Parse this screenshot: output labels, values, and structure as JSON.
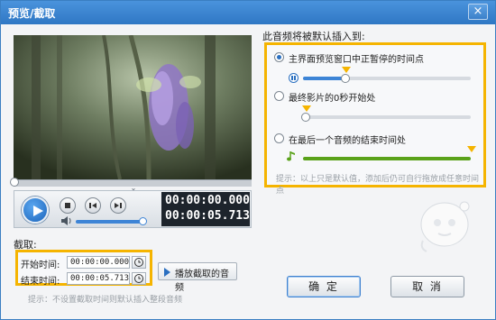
{
  "window": {
    "title": "预览/截取",
    "close_glyph": "×"
  },
  "player": {
    "current_time": "00:00:00.000",
    "total_time": "00:00:05.713",
    "collapse_glyph": "⌄",
    "volume_level": 1.0,
    "progress_level": 0.0
  },
  "insert": {
    "heading": "此音频将被默认插入到:",
    "options": [
      {
        "label": "主界面预览窗口中正暂停的时间点",
        "selected": true
      },
      {
        "label": "最终影片的0秒开始处",
        "selected": false
      },
      {
        "label": "在最后一个音频的结束时间处",
        "selected": false
      }
    ],
    "hint": "提示：以上只是默认值，添加后仍可自行拖放成任意时间点",
    "slider_levels": [
      0.4,
      0.0,
      1.0
    ]
  },
  "trim": {
    "heading": "截取:",
    "start_label": "开始时间:",
    "start_value": "00:00:00.000",
    "end_label": "结束时间:",
    "end_value": "00:00:05.713",
    "play_button": "播放截取的音频",
    "hint": "提示：不设置截取时间则默认插入整段音频"
  },
  "buttons": {
    "ok": "确 定",
    "cancel": "取 消"
  },
  "icons": {
    "play": "play-icon",
    "stop": "stop-icon",
    "prev": "previous-icon",
    "next": "next-icon",
    "volume": "volume-icon",
    "clock": "clock-icon",
    "music": "music-note-icon",
    "mascot": "mascot-icon"
  },
  "colors": {
    "accent": "#3d84d6",
    "highlight": "#f5b400",
    "green": "#5aa21a"
  }
}
